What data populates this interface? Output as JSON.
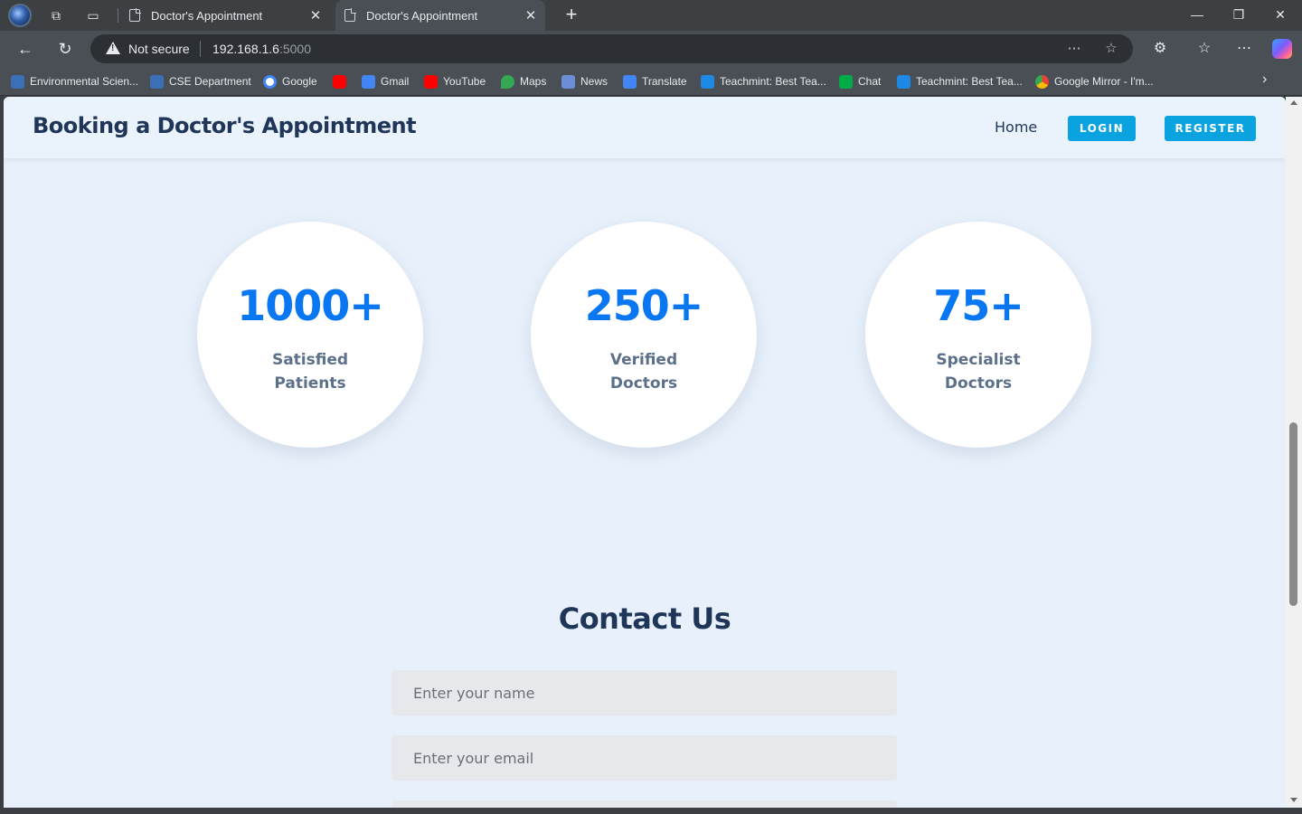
{
  "browser": {
    "tabs": [
      {
        "title": "Doctor's Appointment",
        "active": false
      },
      {
        "title": "Doctor's Appointment",
        "active": true
      }
    ],
    "address": {
      "security_label": "Not secure",
      "host": "192.168.1.6",
      "port": ":5000"
    },
    "bookmarks": [
      {
        "label": "Environmental Scien...",
        "icon": "bookmark-favicon"
      },
      {
        "label": "CSE Department",
        "icon": "bookmark-favicon"
      },
      {
        "label": "Google",
        "icon": "google-icon"
      },
      {
        "label": "",
        "icon": "youtube-icon"
      },
      {
        "label": "Gmail",
        "icon": "docs-icon"
      },
      {
        "label": "YouTube",
        "icon": "youtube-icon"
      },
      {
        "label": "Maps",
        "icon": "maps-icon"
      },
      {
        "label": "News",
        "icon": "news-icon"
      },
      {
        "label": "Translate",
        "icon": "translate-icon"
      },
      {
        "label": "Teachmint: Best Tea...",
        "icon": "teachmint-icon"
      },
      {
        "label": "Chat",
        "icon": "chat-icon"
      },
      {
        "label": "Teachmint: Best Tea...",
        "icon": "teachmint-icon"
      },
      {
        "label": "Google Mirror - I'm...",
        "icon": "chrome-icon"
      }
    ]
  },
  "site": {
    "title": "Booking a Doctor's Appointment",
    "nav": {
      "home": "Home",
      "login": "LOGIN",
      "register": "REGISTER"
    },
    "stats": [
      {
        "value": "1000+",
        "label": "Satisfied Patients"
      },
      {
        "value": "250+",
        "label": "Verified Doctors"
      },
      {
        "value": "75+",
        "label": "Specialist Doctors"
      }
    ],
    "contact": {
      "title": "Contact Us",
      "name_placeholder": "Enter your name",
      "email_placeholder": "Enter your email"
    }
  },
  "colors": {
    "accent": "#0a77f2",
    "button": "#0aa3e0",
    "heading": "#1f3659",
    "page_bg": "#e8f1fb"
  }
}
